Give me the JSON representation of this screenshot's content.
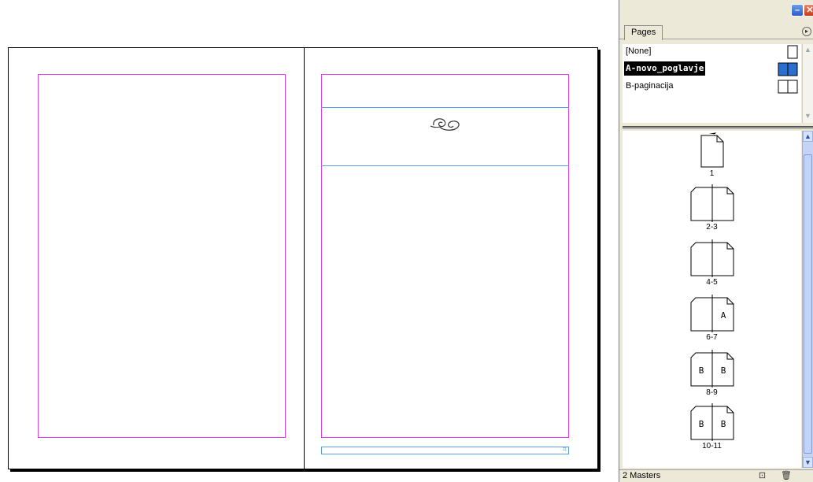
{
  "panel": {
    "tab_label": "Pages",
    "masters": [
      {
        "label": "[None]",
        "selected": false
      },
      {
        "label": "A-novo_poglavje",
        "selected": true
      },
      {
        "label": "B-paginacija",
        "selected": false
      }
    ],
    "pages": [
      {
        "number": "1",
        "type": "single",
        "left_letter": "",
        "right_letter": ""
      },
      {
        "number": "2-3",
        "type": "spread",
        "left_letter": "",
        "right_letter": ""
      },
      {
        "number": "4-5",
        "type": "spread",
        "left_letter": "",
        "right_letter": ""
      },
      {
        "number": "6-7",
        "type": "spread",
        "left_letter": "",
        "right_letter": "A"
      },
      {
        "number": "8-9",
        "type": "spread",
        "left_letter": "B",
        "right_letter": "B"
      },
      {
        "number": "10-11",
        "type": "spread",
        "left_letter": "B",
        "right_letter": "B"
      }
    ],
    "status_text": "2 Masters",
    "icons": {
      "minimize": "minimize-icon",
      "close": "close-icon",
      "panel_menu": "panel-menu-icon",
      "new_page": "new-page-icon",
      "delete": "trash-icon"
    }
  },
  "colors": {
    "margin_guide": "#e040e8",
    "ruler_guide": "#5aa0e0",
    "selection": "#000000"
  }
}
